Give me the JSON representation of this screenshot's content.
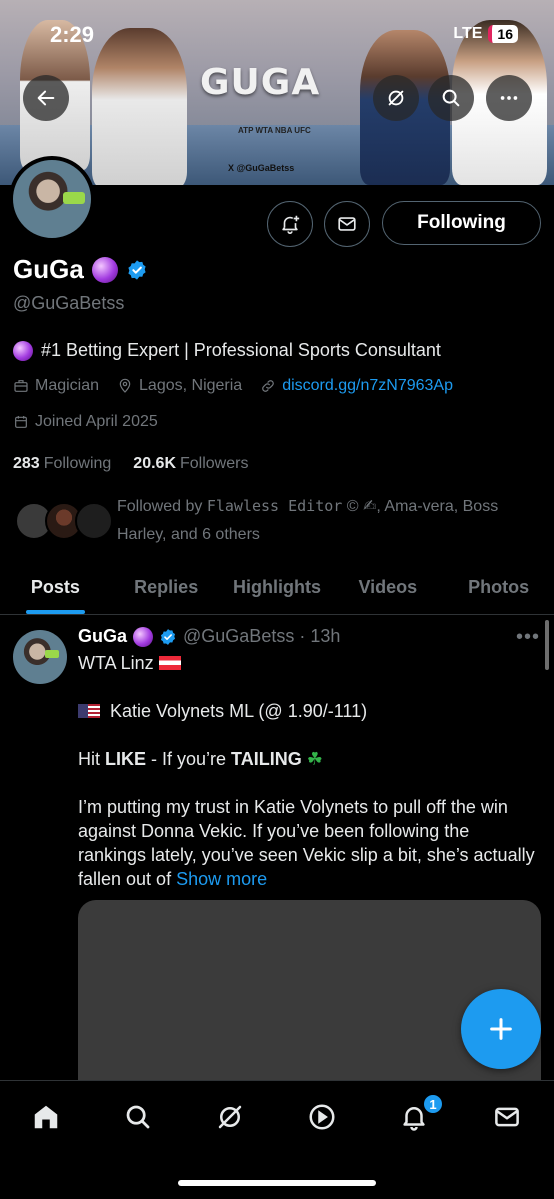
{
  "status_bar": {
    "time": "2:29",
    "network": "LTE",
    "battery": "16"
  },
  "banner": {
    "brand": "GUGA",
    "handle_tag": "X @GuGaBetss",
    "logos": "ATP WTA NBA UFC"
  },
  "profile": {
    "name": "GuGa",
    "handle": "@GuGaBetss",
    "bio": "#1 Betting Expert | Professional Sports Consultant",
    "category": "Magician",
    "location": "Lagos, Nigeria",
    "link": "discord.gg/n7zN7963Ap",
    "joined": "Joined April 2025",
    "following_count": "283",
    "following_label": "Following",
    "followers_count": "20.6K",
    "followers_label": "Followers",
    "followed_by_prefix": "Followed by ",
    "followed_by_mono": "Flawless Editor",
    "followed_by_rest": " © ✍, Ama-vera, Boss Harley, and 6 others"
  },
  "actions": {
    "follow_label": "Following"
  },
  "tabs": [
    {
      "label": "Posts"
    },
    {
      "label": "Replies"
    },
    {
      "label": "Highlights"
    },
    {
      "label": "Videos"
    },
    {
      "label": "Photos"
    }
  ],
  "post": {
    "name": "GuGa",
    "meta": "@GuGaBetss · 13h",
    "line1": "WTA Linz",
    "line2": "Katie Volynets ML (@ 1.90/-111)",
    "line3_pre": "Hit ",
    "line3_b1": "LIKE",
    "line3_mid": " - If you’re ",
    "line3_b2": "TAILING",
    "line3_emoji": "☘",
    "body": "I’m putting my trust in Katie Volynets to pull off the win against Donna Vekic. If you’ve been following the rankings lately, you’ve seen Vekic slip a bit, she’s actually fallen out of ",
    "show_more": "Show more"
  },
  "notifications_badge": "1",
  "icons": [
    "back-arrow-icon",
    "no-signal-icon",
    "search-icon",
    "more-icon",
    "notification-add-icon",
    "mail-icon",
    "verified-icon",
    "briefcase-icon",
    "location-icon",
    "link-icon",
    "calendar-icon",
    "plus-icon",
    "home-icon",
    "grok-icon",
    "play-icon",
    "bell-icon"
  ],
  "colors": {
    "accent": "#1d9bf0",
    "background": "#000000",
    "muted": "#71767b"
  }
}
